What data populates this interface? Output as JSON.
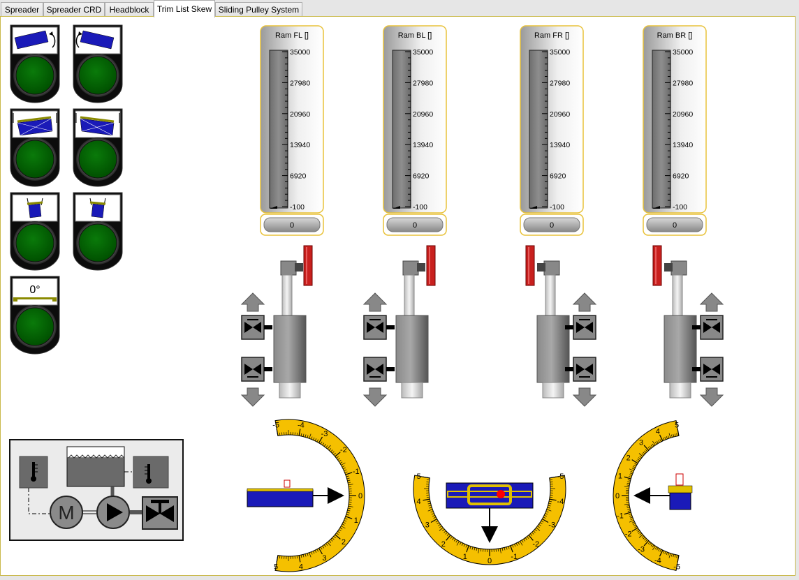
{
  "tabs": [
    {
      "label": "Spreader"
    },
    {
      "label": "Spreader CRD"
    },
    {
      "label": "Headblock"
    },
    {
      "label": "Trim List Skew"
    },
    {
      "label": "Sliding Pulley System"
    }
  ],
  "active_tab": "Trim List Skew",
  "trim_buttons": [
    {
      "name": "skew-ccw-button",
      "icon": "skew-rotate-left-icon"
    },
    {
      "name": "skew-cw-button",
      "icon": "skew-rotate-right-icon"
    },
    {
      "name": "trim-left-button",
      "icon": "trim-left-icon"
    },
    {
      "name": "trim-right-button",
      "icon": "trim-right-icon"
    },
    {
      "name": "list-left-button",
      "icon": "list-left-icon"
    },
    {
      "name": "list-right-button",
      "icon": "list-right-icon"
    },
    {
      "name": "level-zero-button",
      "icon": "level-zero-icon",
      "label": "0°"
    }
  ],
  "gauges": [
    {
      "title": "Ram FL []",
      "value": "0",
      "ticks": [
        "35000",
        "27980",
        "20960",
        "13940",
        "6920",
        "-100"
      ],
      "level": 0
    },
    {
      "title": "Ram BL []",
      "value": "0",
      "ticks": [
        "35000",
        "27980",
        "20960",
        "13940",
        "6920",
        "-100"
      ],
      "level": 0
    },
    {
      "title": "Ram FR []",
      "value": "0",
      "ticks": [
        "35000",
        "27980",
        "20960",
        "13940",
        "6920",
        "-100"
      ],
      "level": 0
    },
    {
      "title": "Ram BR []",
      "value": "0",
      "ticks": [
        "35000",
        "27980",
        "20960",
        "13940",
        "6920",
        "-100"
      ],
      "level": 0
    }
  ],
  "cylinders": [
    {
      "name": "cylinder-fl",
      "valve_side": "left"
    },
    {
      "name": "cylinder-bl",
      "valve_side": "left"
    },
    {
      "name": "cylinder-fr",
      "valve_side": "right"
    },
    {
      "name": "cylinder-br",
      "valve_side": "right"
    }
  ],
  "dials": [
    {
      "name": "trim-dial",
      "labels": [
        "-5",
        "-4",
        "-3",
        "-2",
        "-1",
        "0",
        "1",
        "2",
        "3",
        "4",
        "5"
      ],
      "value": 0
    },
    {
      "name": "skew-dial",
      "labels": [
        "5",
        "4",
        "3",
        "2",
        "1",
        "0",
        "-1",
        "-2",
        "-3",
        "-4",
        "-5"
      ],
      "value": 0
    },
    {
      "name": "list-dial",
      "labels": [
        "5",
        "4",
        "3",
        "2",
        "1",
        "0",
        "-1",
        "-2",
        "-3",
        "-4",
        "-5"
      ],
      "value": 0
    }
  ],
  "hydraulic": {
    "motor_label": "M"
  },
  "colors": {
    "button_green": "#006600",
    "gauge_border": "#e8c23a",
    "dial_yellow": "#f5c000",
    "load_blue": "#1a1ab8",
    "valve_red": "#c8201e"
  }
}
